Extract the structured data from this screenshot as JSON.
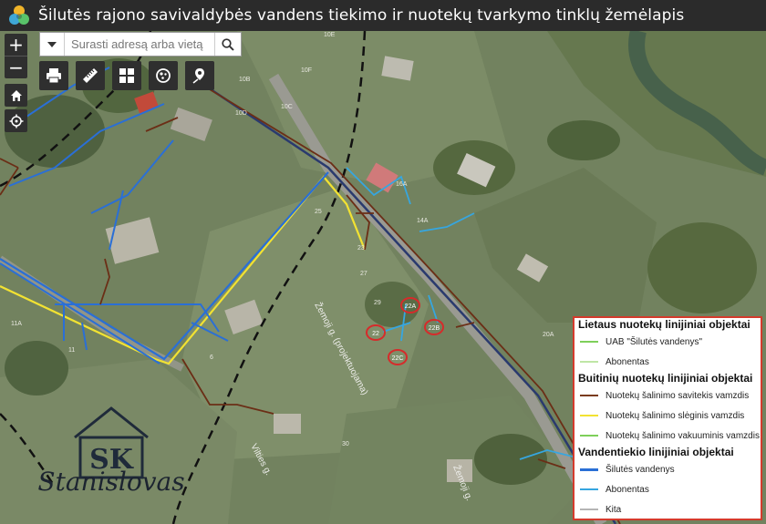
{
  "header": {
    "title": "Šilutės rajono savivaldybės vandens tiekimo ir nuotekų tvarkymo tinklų žemėlapis"
  },
  "zoom": {
    "in_label": "+",
    "out_label": "−"
  },
  "search": {
    "placeholder": "Surasti adresą arba vietą"
  },
  "tools": [
    "printer-icon",
    "measure-icon",
    "basemap-gallery-icon",
    "layers-icon",
    "locate-pin-icon"
  ],
  "legend": {
    "sections": [
      {
        "title": "Lietaus nuotekų linijiniai objektai",
        "items": [
          {
            "label": "UAB \"Šilutės vandenys\"",
            "color": "#7ecf5a"
          },
          {
            "label": "Abonentas",
            "color": "#bfe6a6"
          }
        ]
      },
      {
        "title": "Buitinių nuotekų linijiniai objektai",
        "items": [
          {
            "label": "Nuotekų šalinimo savitekis vamzdis",
            "color": "#7a3b1c"
          },
          {
            "label": "Nuotekų šalinimo slėginis vamzdis",
            "color": "#f2e232"
          },
          {
            "label": "Nuotekų šalinimo vakuuminis vamzdis",
            "color": "#7ecf5a"
          }
        ]
      },
      {
        "title": "Vandentiekio linijiniai objektai",
        "items": [
          {
            "label": "Šilutės vandenys",
            "color": "#2a6fd6"
          },
          {
            "label": "Abonentas",
            "color": "#36a6e0"
          },
          {
            "label": "Kita",
            "color": "#b5b5b5"
          }
        ]
      }
    ]
  },
  "map_labels": {
    "parcels": [
      "10E",
      "10F",
      "10C",
      "10B",
      "10D",
      "16A",
      "14A",
      "23",
      "25",
      "27",
      "29",
      "11A",
      "11",
      "6",
      "20A",
      "30"
    ],
    "streets": [
      "Žemoji g.",
      "Vilties g.",
      "Žemoji g. (projektuojama)"
    ],
    "marked_plots": [
      "22A",
      "22",
      "22B",
      "22C"
    ]
  },
  "watermark": {
    "name": "Stanislovas",
    "initials": "SK"
  }
}
